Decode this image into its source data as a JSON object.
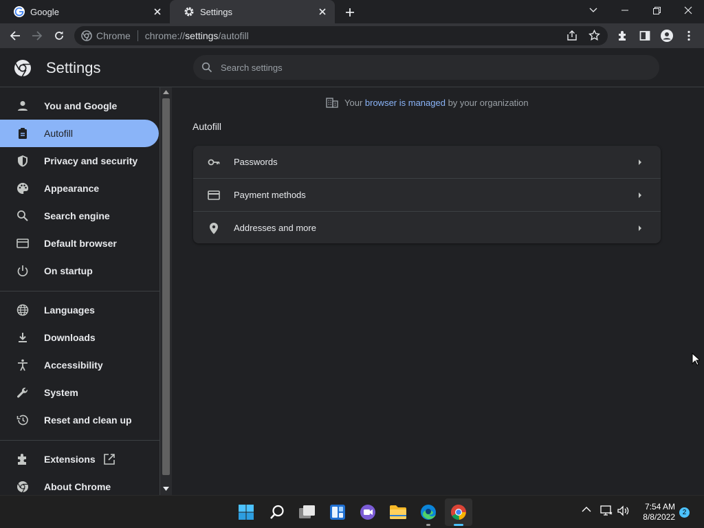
{
  "browser": {
    "tabs": [
      {
        "title": "Google",
        "active": false
      },
      {
        "title": "Settings",
        "active": true
      }
    ],
    "omnibox": {
      "site_label": "Chrome",
      "url_scheme": "chrome://",
      "url_host": "settings",
      "url_path": "/autofill"
    }
  },
  "settings": {
    "title": "Settings",
    "search_placeholder": "Search settings",
    "managed_notice": {
      "prefix": "Your ",
      "link": "browser is managed",
      "suffix": " by your organization"
    },
    "section_title": "Autofill",
    "nav_items": [
      {
        "label": "You and Google",
        "icon": "person-icon"
      },
      {
        "label": "Autofill",
        "icon": "clipboard-icon",
        "active": true
      },
      {
        "label": "Privacy and security",
        "icon": "shield-icon"
      },
      {
        "label": "Appearance",
        "icon": "palette-icon"
      },
      {
        "label": "Search engine",
        "icon": "search-icon"
      },
      {
        "label": "Default browser",
        "icon": "browser-window-icon"
      },
      {
        "label": "On startup",
        "icon": "power-icon"
      },
      {
        "label": "Languages",
        "icon": "globe-icon"
      },
      {
        "label": "Downloads",
        "icon": "download-icon"
      },
      {
        "label": "Accessibility",
        "icon": "accessibility-icon"
      },
      {
        "label": "System",
        "icon": "wrench-icon"
      },
      {
        "label": "Reset and clean up",
        "icon": "history-icon"
      },
      {
        "label": "Extensions",
        "icon": "puzzle-icon"
      },
      {
        "label": "About Chrome",
        "icon": "chrome-icon"
      }
    ],
    "autofill_rows": [
      {
        "label": "Passwords",
        "icon": "key-icon"
      },
      {
        "label": "Payment methods",
        "icon": "credit-card-icon"
      },
      {
        "label": "Addresses and more",
        "icon": "location-pin-icon"
      }
    ]
  },
  "taskbar": {
    "time": "7:54 AM",
    "date": "8/8/2022",
    "notification_count": "2"
  },
  "colors": {
    "accent": "#8ab4f8",
    "background": "#202124",
    "card": "#292a2d",
    "toolbar": "#35363a"
  }
}
